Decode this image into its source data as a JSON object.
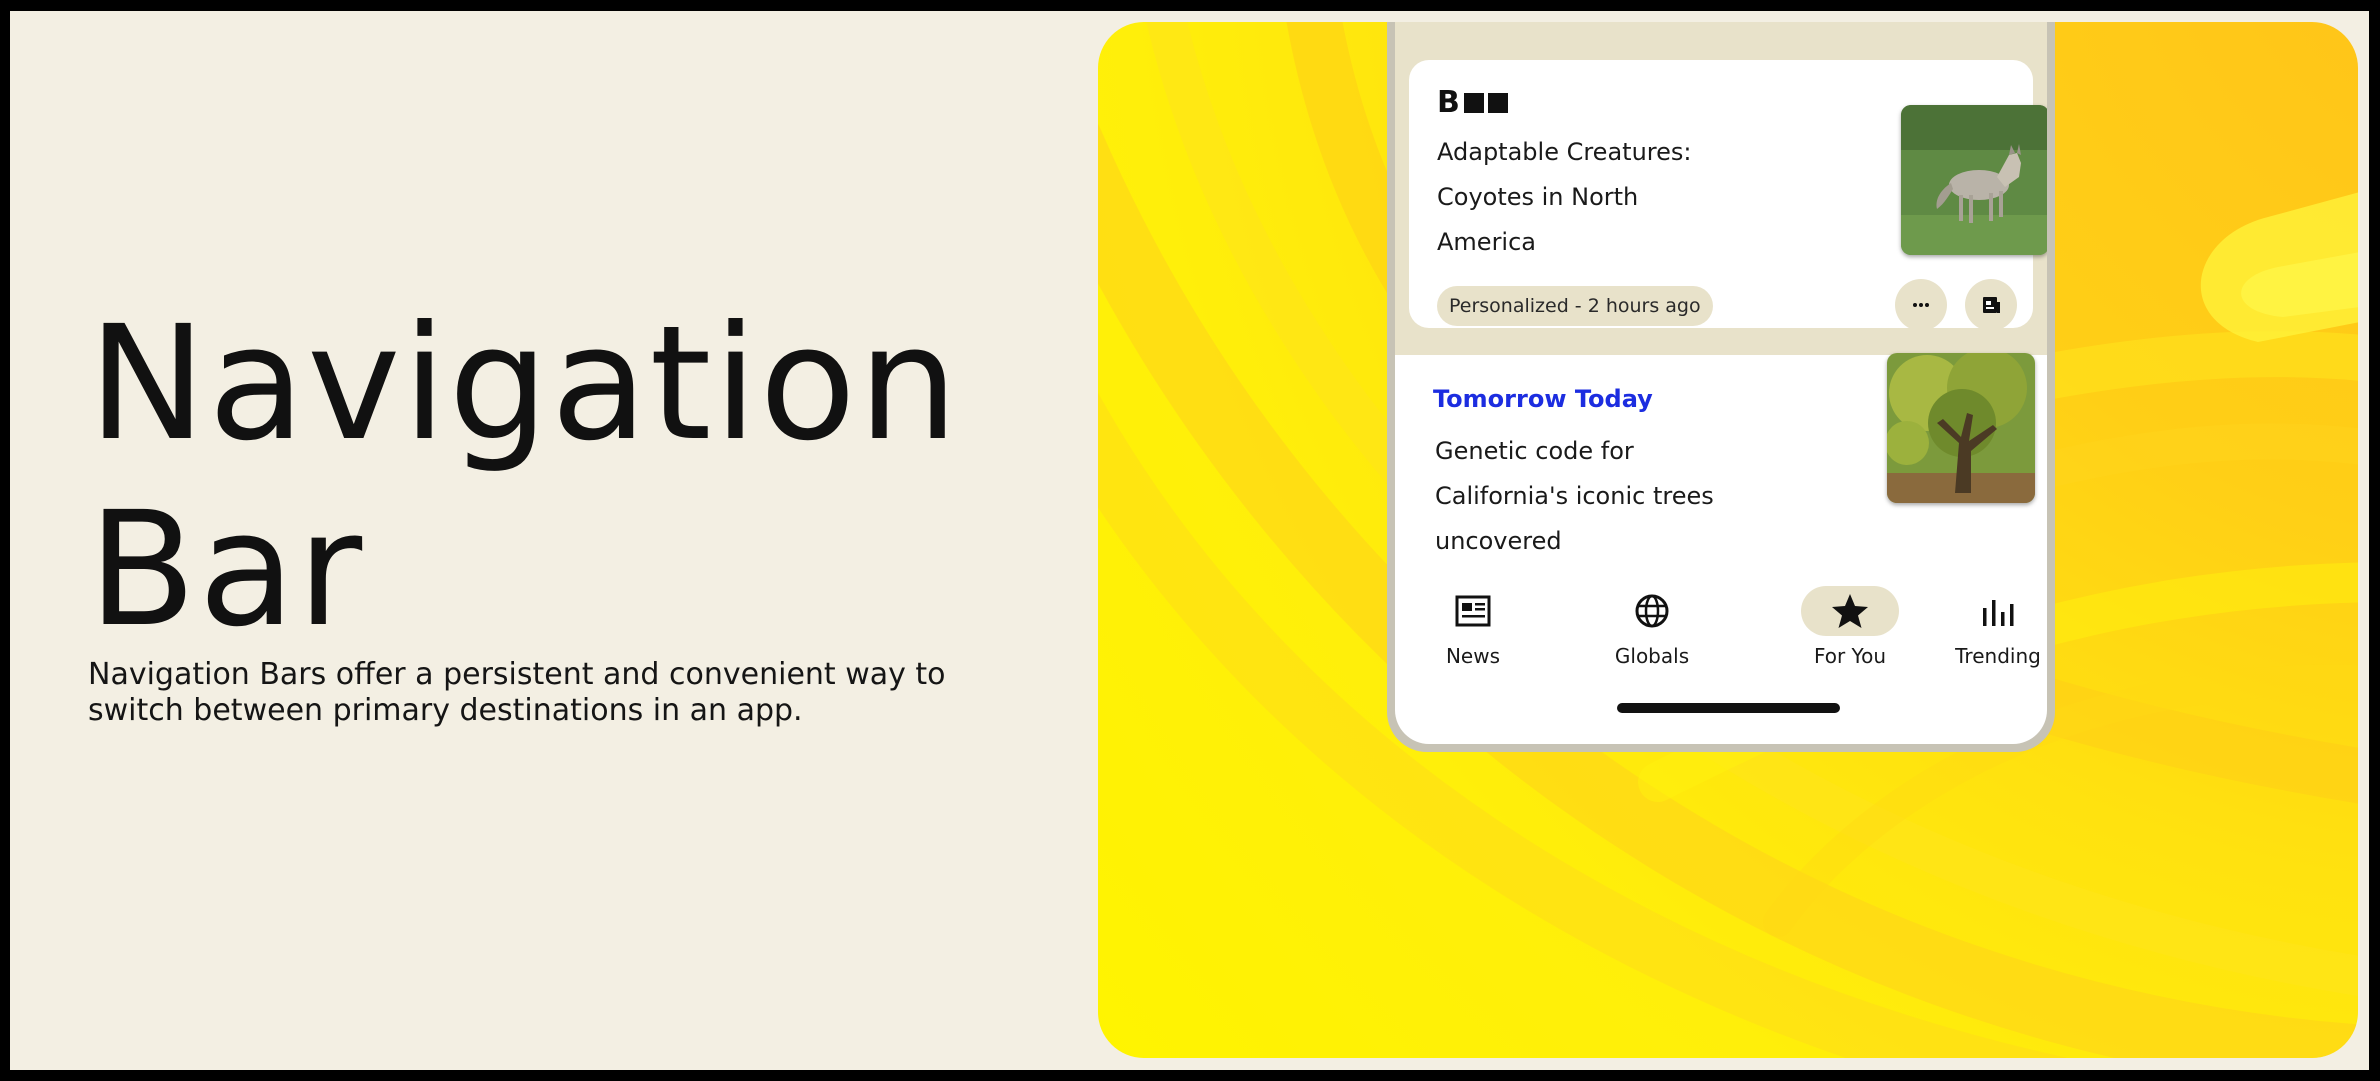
{
  "hero": {
    "title_line1": "Navigation",
    "title_line2": "Bar",
    "description_line1": "Navigation Bars offer a persistent and convenient way to",
    "description_line2": "switch between primary destinations in an app."
  },
  "colors": {
    "page_background": "#f3efe3",
    "panel_yellow": "#ffe20f",
    "chip_background": "#e8e2ca",
    "source_link": "#1c2de0"
  },
  "feed": {
    "card": {
      "logo_letter": "B",
      "title_line1": "Adaptable Creatures:",
      "title_line2": "Coyotes in North",
      "title_line3": "America",
      "meta_chip": "Personalized - 2 hours ago",
      "thumbnail_icon": "coyote-photo",
      "actions": [
        "more-icon",
        "article-icon"
      ]
    },
    "story": {
      "source": "Tomorrow Today",
      "title_line1": "Genetic code for",
      "title_line2": "California's iconic trees",
      "title_line3": "uncovered",
      "thumbnail_icon": "oak-tree-photo"
    }
  },
  "nav": {
    "items": [
      {
        "label": "News",
        "icon": "newspaper-icon",
        "active": false
      },
      {
        "label": "Globals",
        "icon": "globe-icon",
        "active": false
      },
      {
        "label": "For You",
        "icon": "star-icon",
        "active": true
      },
      {
        "label": "Trending",
        "icon": "bar-chart-icon",
        "active": false
      }
    ]
  }
}
